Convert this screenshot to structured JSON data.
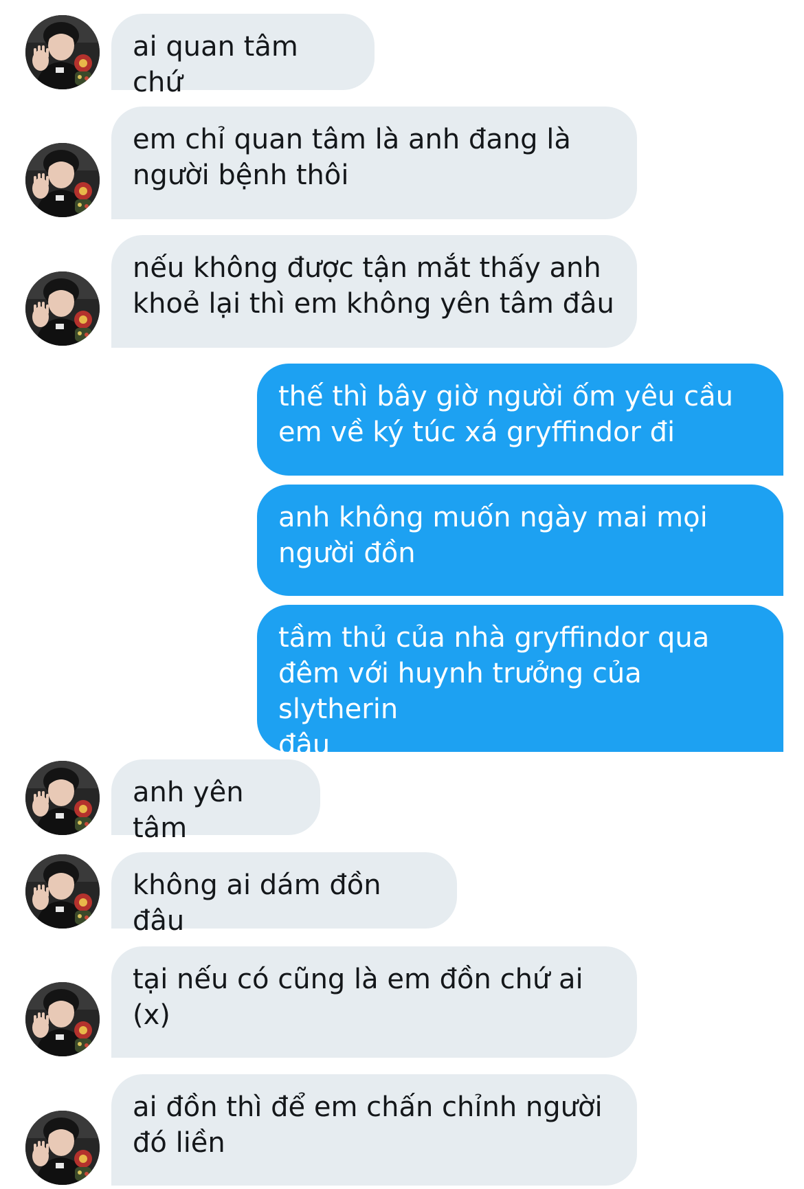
{
  "conversation": {
    "messages": [
      {
        "side": "incoming",
        "text": "ai quan tâm chứ"
      },
      {
        "side": "incoming",
        "text": "em chỉ quan tâm là anh đang là\nngười bệnh thôi"
      },
      {
        "side": "incoming",
        "text": "nếu không được tận mắt thấy anh\nkhoẻ lại thì em không yên tâm đâu"
      },
      {
        "side": "outgoing",
        "text": "thế thì bây giờ người ốm yêu cầu\nem về ký túc xá gryffindor đi"
      },
      {
        "side": "outgoing",
        "text": "anh không muốn ngày mai mọi\nngười đồn"
      },
      {
        "side": "outgoing",
        "text": "tầm thủ của nhà gryffindor qua\nđêm với huynh trưởng của slytherin\nđâu"
      },
      {
        "side": "incoming",
        "text": "anh yên tâm"
      },
      {
        "side": "incoming",
        "text": "không ai dám đồn đâu"
      },
      {
        "side": "incoming",
        "text": "tại nếu có cũng là em đồn chứ ai\n(x)"
      },
      {
        "side": "incoming",
        "text": "ai đồn thì để em chấn chỉnh người\nđó liền"
      }
    ]
  },
  "colors": {
    "incoming_bubble": "#e6ecf0",
    "incoming_text": "#14171a",
    "outgoing_bubble": "#1da1f2",
    "outgoing_text": "#ffffff",
    "background": "#ffffff"
  },
  "icons": {
    "avatar": "profile-photo-avatar"
  }
}
